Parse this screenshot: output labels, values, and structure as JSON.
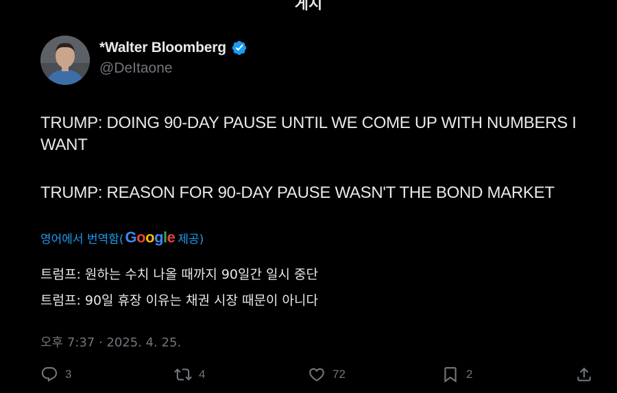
{
  "header": {
    "title": "게시"
  },
  "author": {
    "display_name": "*Walter Bloomberg",
    "handle": "@DeItaone",
    "verified": true
  },
  "tweet": {
    "paragraphs": [
      "TRUMP: DOING 90-DAY PAUSE UNTIL WE COME UP WITH NUMBERS I WANT",
      "TRUMP: REASON FOR 90-DAY PAUSE WASN'T THE BOND MARKET"
    ]
  },
  "translation": {
    "link_prefix": "영어에서 번역함(",
    "provider": "Google",
    "link_suffix": " 제공)",
    "lines": [
      "트럼프: 원하는 수치 나올 때까지 90일간 일시 중단",
      "트럼프: 90일 휴장 이유는 채권 시장 때문이 아니다"
    ]
  },
  "timestamp": "오후 7:37 · 2025. 4. 25.",
  "actions": {
    "replies": "3",
    "reposts": "4",
    "likes": "72",
    "bookmarks": "2"
  },
  "colors": {
    "background": "#000000",
    "text": "#e7e9ea",
    "muted": "#71767b",
    "link": "#1d9bf0",
    "verified": "#1d9bf0"
  },
  "icons": [
    "reply-icon",
    "repost-icon",
    "like-icon",
    "bookmark-icon",
    "share-icon",
    "verified-badge-icon"
  ]
}
